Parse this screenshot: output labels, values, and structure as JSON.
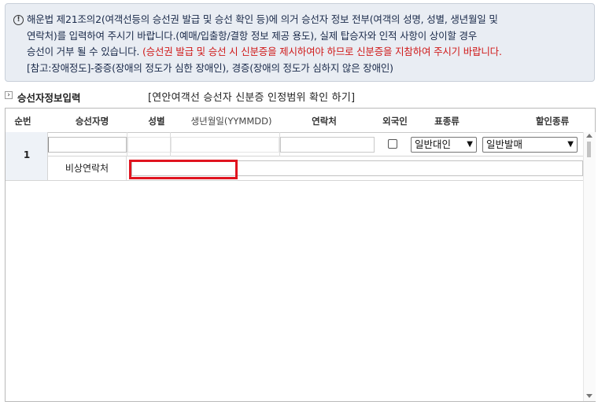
{
  "notice": {
    "icon": "exclamation-icon",
    "line1": "해운법 제21조의2(여객선등의 승선권 발급 및 승선 확인 등)에 의거 승선자 정보 전부(여객의 성명, 성별, 생년월일 및",
    "line2": "연락처)를 입력하여 주시기 바랍니다.(예매/입출항/결항 정보 제공 용도), 실제 탑승자와 인적 사항이 상이할 경우",
    "line3_normal": "승선이 거부 될 수 있습니다. ",
    "line3_red": "(승선권 발급 및 승선 시 신분증을 제시하여야 하므로 신분증을 지참하여 주시기 바랍니다.",
    "line4": "[참고:장애정도]-중증(장애의 정도가 심한 장애인), 경증(장애의 정도가 심하지 않은 장애인)",
    "red_color": "#d01a1a"
  },
  "section": {
    "title": "승선자정보입력",
    "link": "[연안여객선 승선자 신분증 인정범위 확인 하기]"
  },
  "table": {
    "headers": {
      "seq": "순번",
      "name": "승선자명",
      "gender": "성별",
      "birth": "생년월일(YYMMDD)",
      "contact": "연락처",
      "foreigner": "외국인",
      "ticket_type": "표종류",
      "discount_type": "할인종류"
    },
    "rows": [
      {
        "seq": "1",
        "name": "",
        "gender": "",
        "birth": "",
        "contact": "",
        "foreigner": false,
        "ticket_type": "일반대인",
        "discount_type": "일반발매",
        "emergency_label": "비상연락처",
        "emergency_value": ""
      }
    ]
  },
  "colors": {
    "highlight": "#e0141f",
    "notice_bg": "#e9edf3"
  }
}
